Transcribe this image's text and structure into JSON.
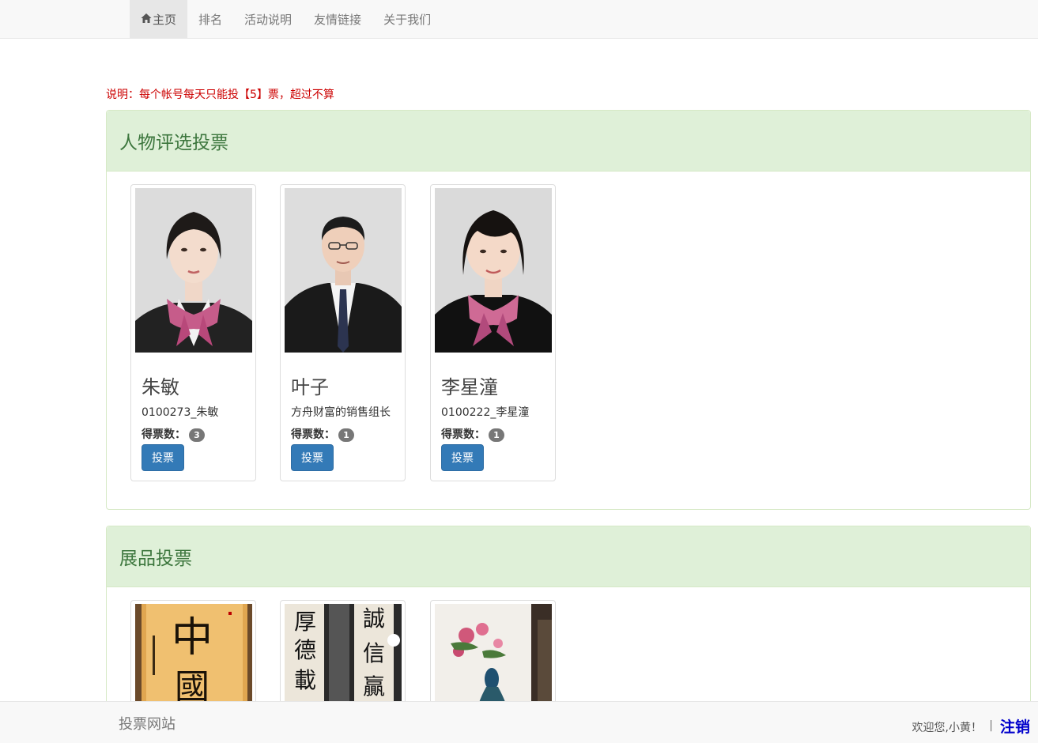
{
  "nav": {
    "items": [
      {
        "label": "主页",
        "icon": "home-icon",
        "active": true
      },
      {
        "label": "排名"
      },
      {
        "label": "活动说明"
      },
      {
        "label": "友情链接"
      },
      {
        "label": "关于我们"
      }
    ]
  },
  "notice": "说明：每个帐号每天只能投【5】票，超过不算",
  "panels": [
    {
      "title": "人物评选投票",
      "cards": [
        {
          "name": "朱敏",
          "desc": "0100273_朱敏",
          "votes_label": "得票数：",
          "votes": "3",
          "button": "投票",
          "photo": "female-portrait-photo"
        },
        {
          "name": "叶子",
          "desc": "方舟财富的销售组长",
          "votes_label": "得票数：",
          "votes": "1",
          "button": "投票",
          "photo": "male-portrait-photo"
        },
        {
          "name": "李星潼",
          "desc": "0100222_李星潼",
          "votes_label": "得票数：",
          "votes": "1",
          "button": "投票",
          "photo": "female-portrait-photo"
        }
      ]
    },
    {
      "title": "展品投票",
      "cards": [
        {
          "photo": "calligraphy-photo",
          "glyphs": [
            "中",
            "國"
          ]
        },
        {
          "photo": "calligraphy-couplet-photo",
          "glyphs": [
            "厚",
            "德",
            "載",
            "誠",
            "信",
            "贏"
          ]
        },
        {
          "photo": "peacock-painting-photo"
        }
      ]
    }
  ],
  "footer": {
    "brand": "投票网站",
    "welcome": "欢迎您,小黄！",
    "separator": "|",
    "logout": "注销"
  },
  "colors": {
    "primary": "#337ab7",
    "panel_heading_bg": "#dff0d8",
    "panel_title": "#3c763d",
    "notice": "#cc0000",
    "logout": "#0000cc"
  }
}
